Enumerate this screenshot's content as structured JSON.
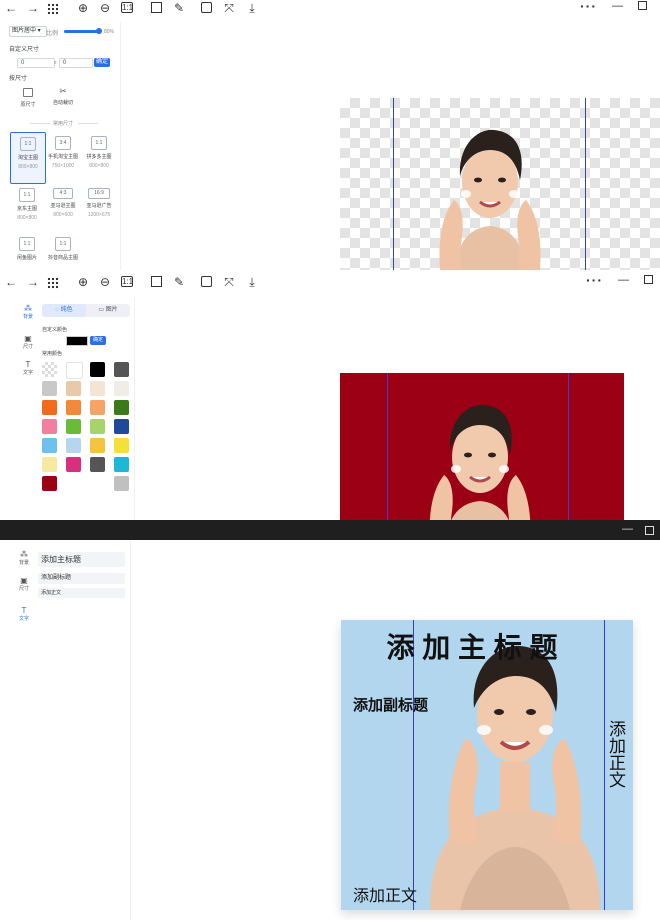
{
  "panel1": {
    "toolbar_icons": [
      "arrow-left-icon",
      "arrow-right-icon",
      "grid-icon",
      "zoom-in-icon",
      "zoom-out-icon",
      "fit-1to1-icon",
      "rotate-icon",
      "edit-icon",
      "layers-icon",
      "crop-fit-icon",
      "download-icon"
    ],
    "ratio_label": "1:1",
    "align_select": "图片居中",
    "ratio_text": "比例",
    "zoom_value": "80%",
    "custom_size_label": "自定义尺寸",
    "width_value": "0",
    "height_value": "0",
    "times_sign": "x",
    "confirm_btn": "确定",
    "original_size_label": "按尺寸",
    "tools": [
      {
        "label": "原尺寸",
        "icon": "image-icon"
      },
      {
        "label": "自动裁切",
        "icon": "scissors-icon"
      }
    ],
    "common_sizes_label": "常用尺寸",
    "sizes": [
      {
        "ratio": "1:1",
        "name": "淘宝主图",
        "dim": "800×800"
      },
      {
        "ratio": "3:4",
        "name": "手机淘宝主图",
        "dim": "750×1000"
      },
      {
        "ratio": "1:1",
        "name": "拼多多主图",
        "dim": "800×800"
      },
      {
        "ratio": "1:1",
        "name": "京东主图",
        "dim": "800×800"
      },
      {
        "ratio": "4:3",
        "name": "亚马逊主图",
        "dim": "800×600"
      },
      {
        "ratio": "16:9",
        "name": "亚马逊广告",
        "dim": "1200×675"
      },
      {
        "ratio": "1:1",
        "name": "闲鱼图片",
        "dim": "800×800"
      },
      {
        "ratio": "1:1",
        "name": "抖音商品主图",
        "dim": ""
      }
    ]
  },
  "panel2": {
    "tab_color": "纯色",
    "tab_image": "图片",
    "side_nav": [
      {
        "label": "背景",
        "icon": "pattern-icon"
      },
      {
        "label": "尺寸",
        "icon": "image-size-icon"
      },
      {
        "label": "文字",
        "icon": "text-icon"
      }
    ],
    "custom_color_label": "自定义颜色",
    "confirm_btn": "确定",
    "common_colors_label": "常用颜色",
    "selected_color": "#000000",
    "canvas_bg": "#9c0015",
    "colors": [
      [
        "transparent",
        "#ffffff",
        "#000000",
        "#555555"
      ],
      [
        "#c8c8c8",
        "#e8c9a8",
        "#f4e4d4",
        "#f0ece6"
      ],
      [
        "#f26a1b",
        "#f2883a",
        "#f4a566",
        "#3a7a1b"
      ],
      [
        "#f27ea0",
        "#6bbb3a",
        "#a6d46a",
        "#1e4a9c"
      ],
      [
        "#6ec0ee",
        "#b6d6ee",
        "#f5c242",
        "#f5e03a"
      ],
      [
        "#f5eaa0",
        "#d6307e",
        "#555555",
        "#1eb8d6"
      ],
      [
        "#9c0015",
        "",
        "",
        "#c0c0c0"
      ]
    ]
  },
  "panel3": {
    "side_nav": [
      {
        "label": "背景",
        "icon": "pattern-icon"
      },
      {
        "label": "尺寸",
        "icon": "image-size-icon"
      },
      {
        "label": "文字",
        "icon": "text-icon"
      }
    ],
    "text_items": [
      "添加主标题",
      "添加副标题",
      "添加正文"
    ],
    "canvas_bg": "#b3d6ef",
    "main_title": "添 加 主 标 题",
    "sub_title": "添加副标题",
    "vertical_body": "添加正文",
    "bottom_body": "添加正文"
  }
}
